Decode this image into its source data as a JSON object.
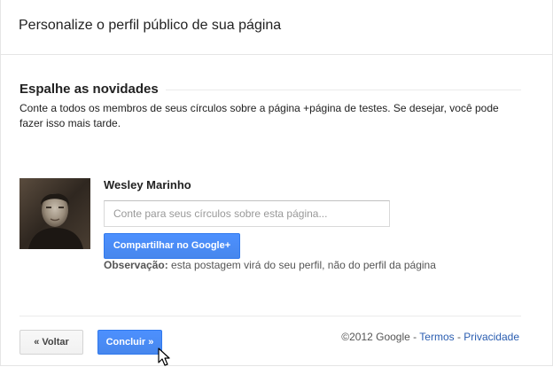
{
  "dialog": {
    "title": "Personalize o perfil público de sua página"
  },
  "section": {
    "title": "Espalhe as novidades",
    "description": "Conte a todos os membros de seus círculos sobre a página +página de testes. Se desejar, você pode fazer isso mais tarde."
  },
  "share": {
    "user_name": "Wesley Marinho",
    "input_value": "",
    "input_placeholder": "Conte para seus círculos sobre esta página...",
    "button_label": "Compartilhar no Google+",
    "note_label": "Observação:",
    "note_text": " esta postagem virá do seu perfil, não do perfil da página"
  },
  "footer": {
    "back_label": "« Voltar",
    "finish_label": "Concluir »",
    "copyright": "©2012 Google",
    "separator": " - ",
    "terms_label": "Termos",
    "privacy_label": "Privacidade"
  },
  "colors": {
    "primary_button": "#4d90fe",
    "link": "#2a5db0"
  },
  "icons": {
    "avatar": "user-photo",
    "cursor": "mouse-pointer-icon"
  }
}
